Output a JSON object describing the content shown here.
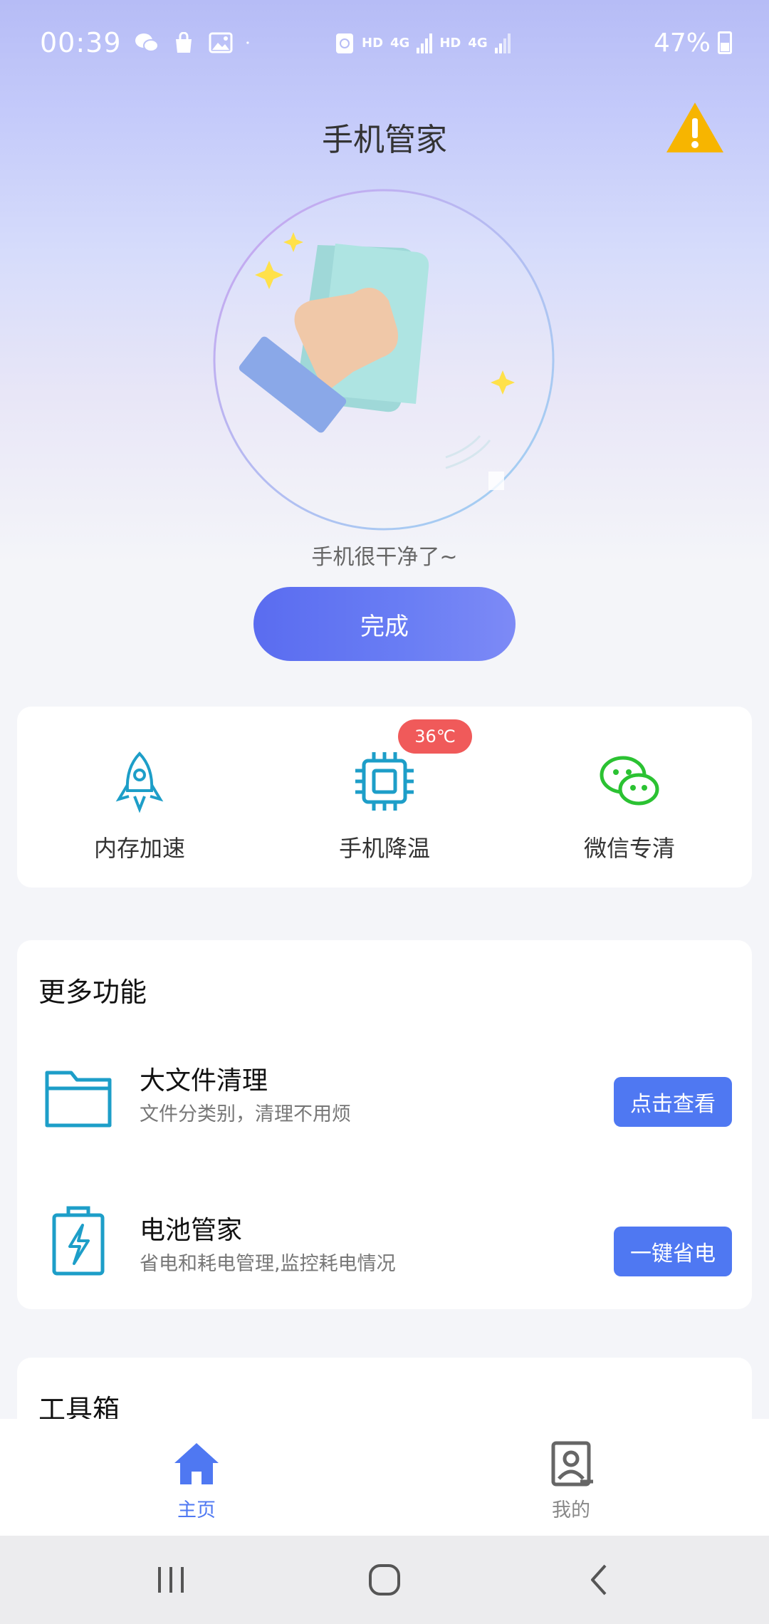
{
  "status_bar": {
    "time": "00:39",
    "network_labels": [
      "HD",
      "4G",
      "HD",
      "4G"
    ],
    "battery": "47%"
  },
  "header": {
    "title": "手机管家"
  },
  "hero": {
    "caption": "手机很干净了~",
    "done_label": "完成"
  },
  "quick_actions": [
    {
      "label": "内存加速",
      "icon": "rocket-icon"
    },
    {
      "label": "手机降温",
      "icon": "chip-icon",
      "badge": "36℃"
    },
    {
      "label": "微信专清",
      "icon": "wechat-icon"
    }
  ],
  "more": {
    "title": "更多功能",
    "items": [
      {
        "title": "大文件清理",
        "subtitle": "文件分类别，清理不用烦",
        "button": "点击查看",
        "icon": "folder-icon"
      },
      {
        "title": "电池管家",
        "subtitle": "省电和耗电管理,监控耗电情况",
        "button": "一键省电",
        "icon": "battery-icon"
      }
    ]
  },
  "tools": {
    "title": "工具箱"
  },
  "bottom_nav": [
    {
      "label": "主页",
      "icon": "home-icon"
    },
    {
      "label": "我的",
      "icon": "profile-icon"
    }
  ],
  "colors": {
    "primary": "#4f78f2",
    "badge": "#f05a5a",
    "warning": "#f7b500"
  }
}
